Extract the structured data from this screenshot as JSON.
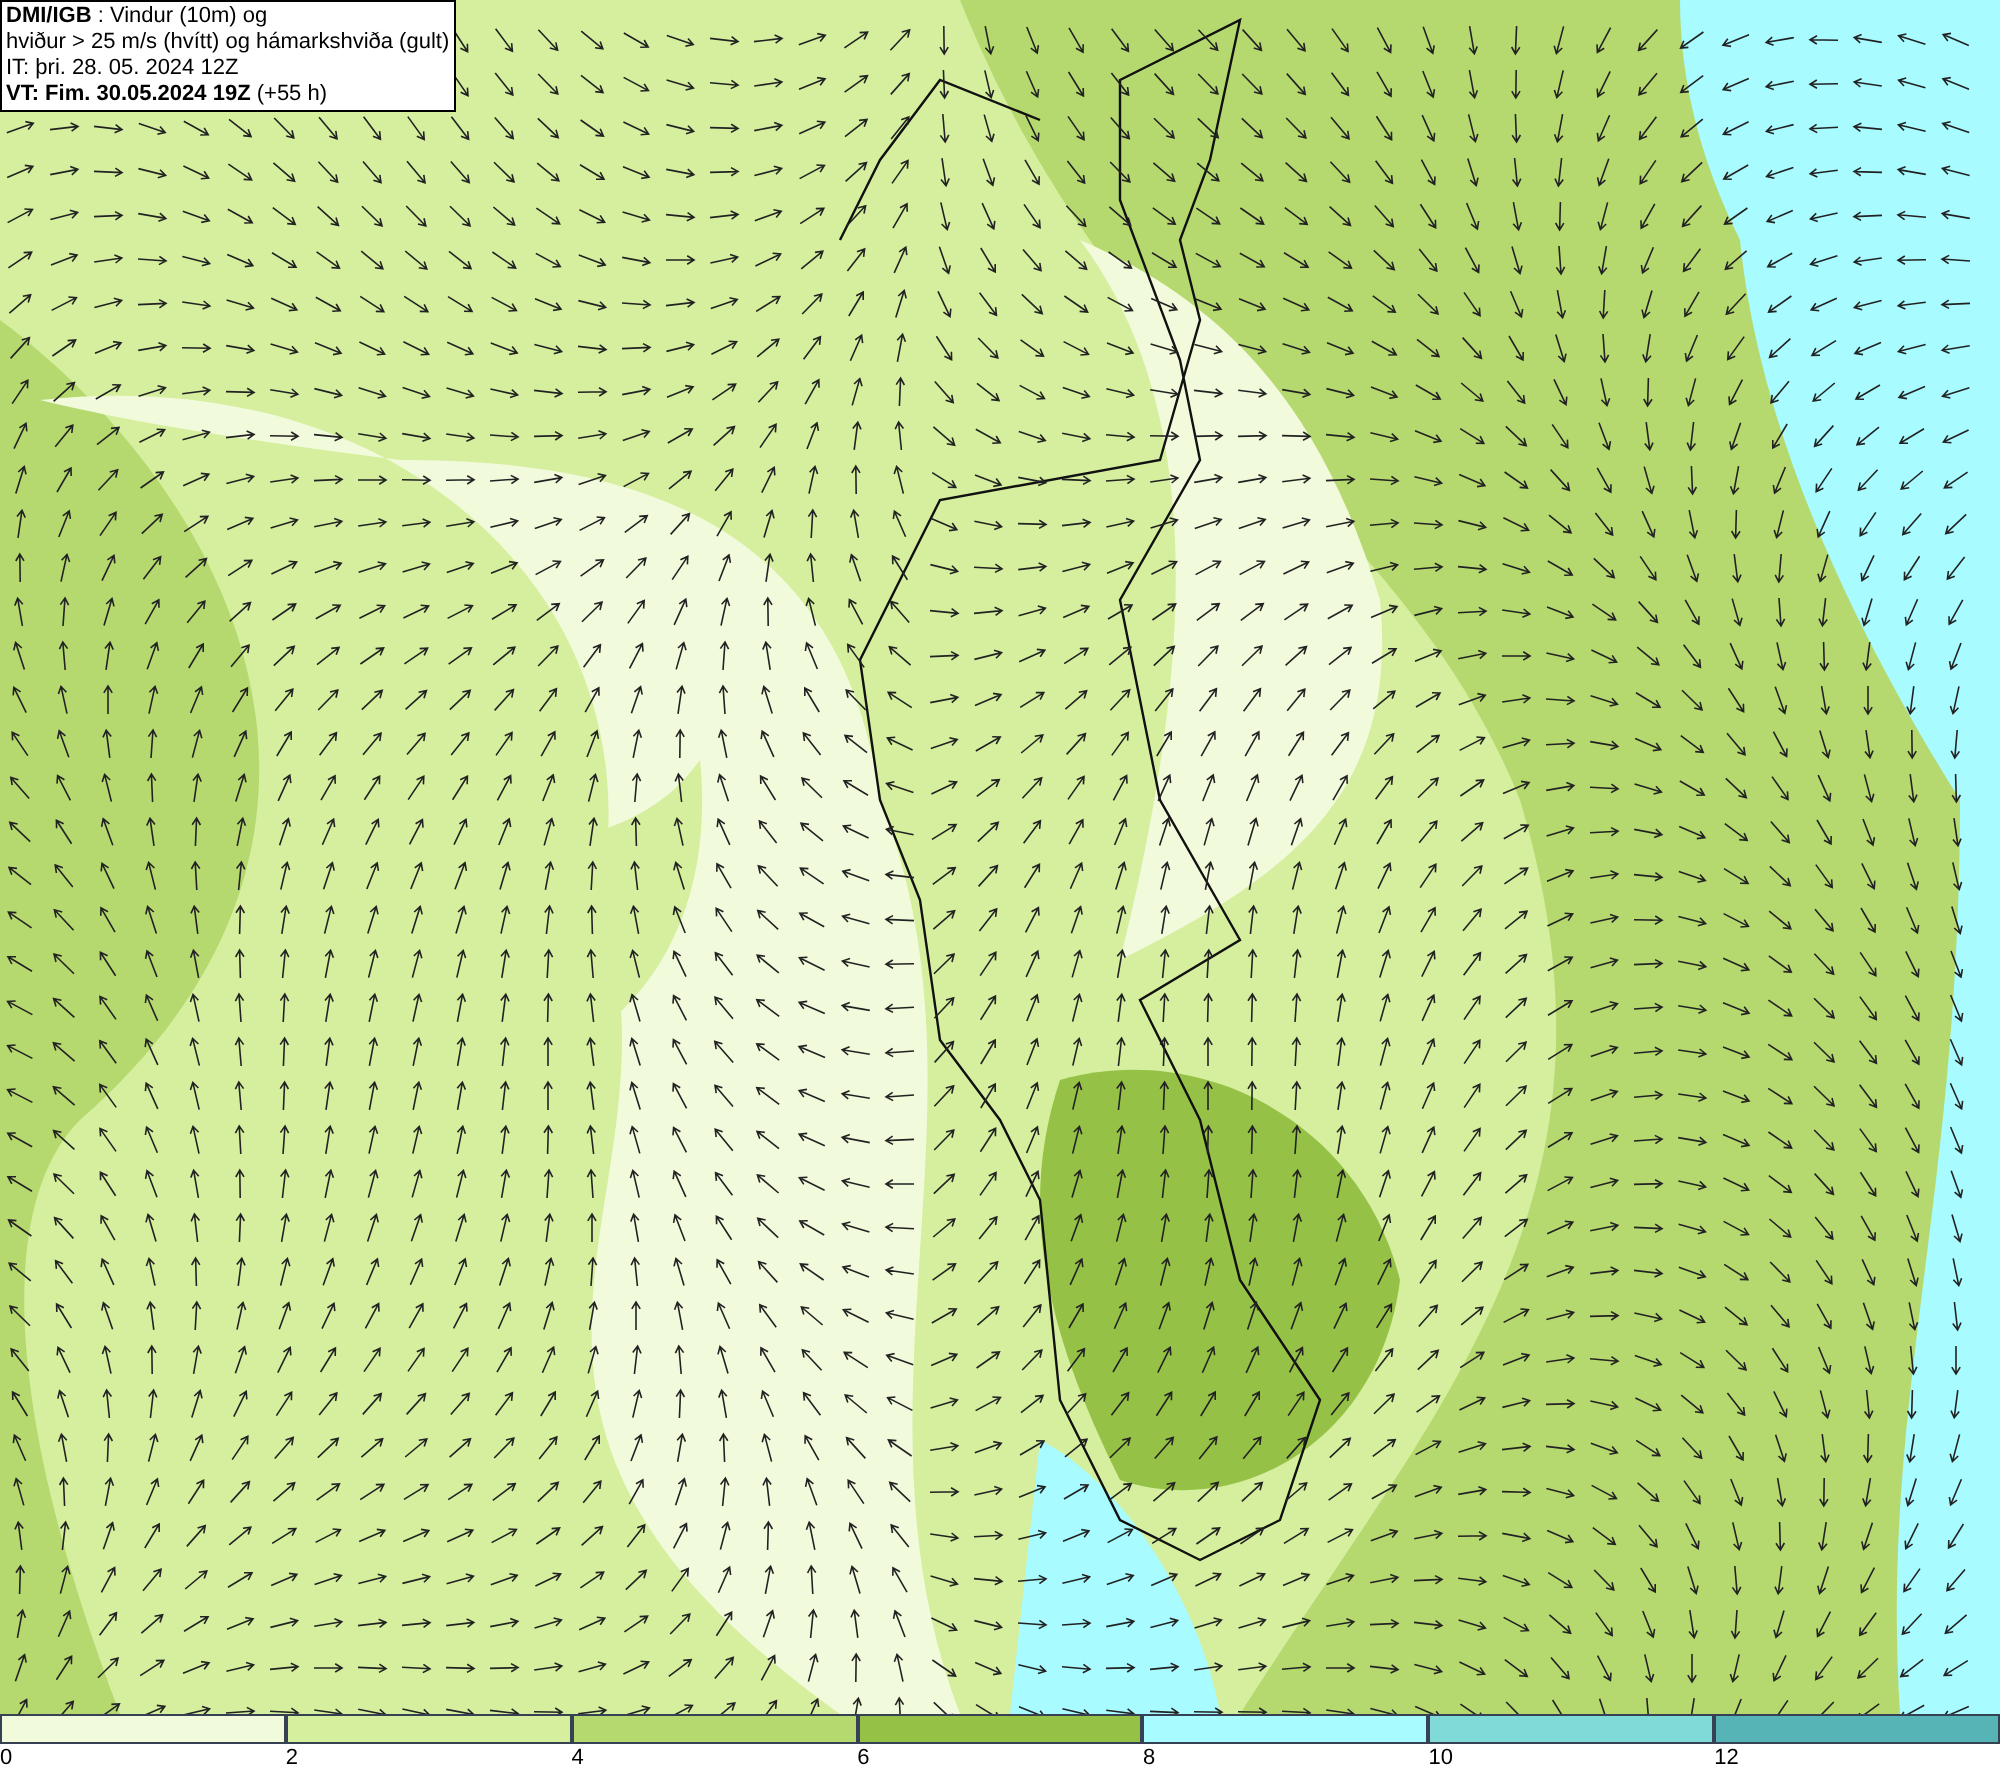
{
  "header": {
    "lines": [
      "**DMI/IGB** : Vindur (10m) og",
      "hviður > 25 m/s (hvítt) og hámarkshviða (gult)",
      "IT: þri. 28. 05. 2024 12Z",
      "**VT: Fim. 30.05.2024 19Z** (+55 h)"
    ]
  },
  "legend": {
    "bands": [
      {
        "color": "#f2fadc",
        "label": "0"
      },
      {
        "color": "#d5ef9e",
        "label": "2"
      },
      {
        "color": "#b5d96f",
        "label": "4"
      },
      {
        "color": "#95c246",
        "label": "6"
      },
      {
        "color": "#a8fbff",
        "label": "8"
      },
      {
        "color": "#80dad8",
        "label": "10"
      },
      {
        "color": "#56b4b6",
        "label": "12"
      }
    ]
  }
}
